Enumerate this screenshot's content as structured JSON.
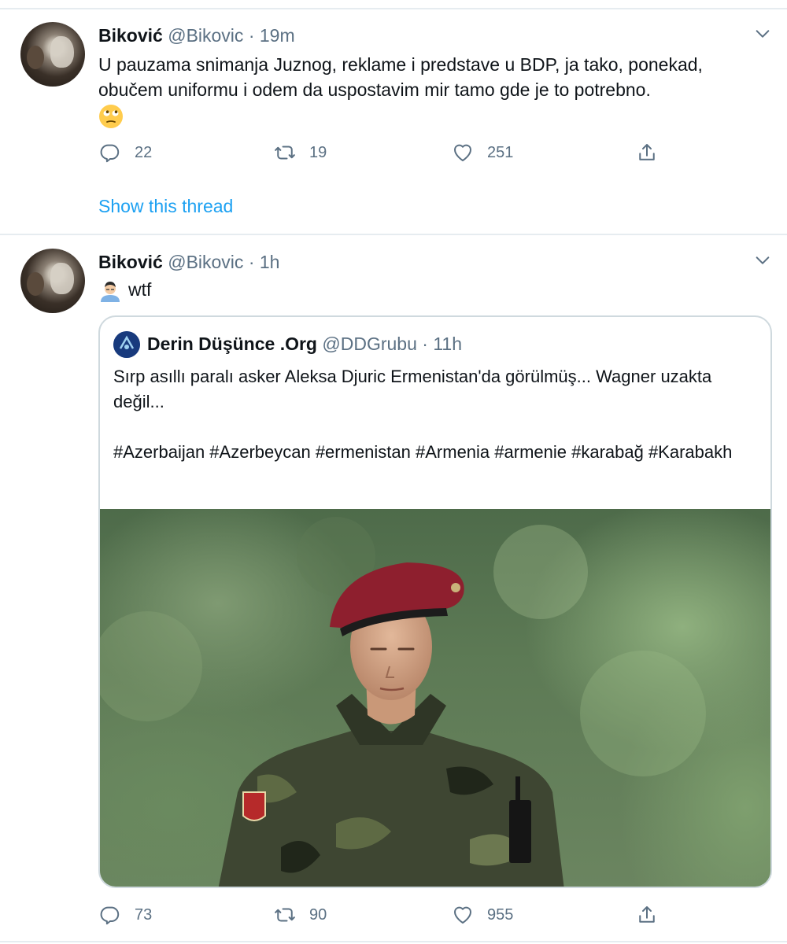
{
  "tweets": [
    {
      "name": "Biković",
      "handle": "@Bikovic",
      "time": "19m",
      "text": "U pauzama snimanja Juznog, reklame i predstave u BDP, ja tako, ponekad, obučem uniformu i odem da uspostavim mir tamo gde je to potrebno.",
      "emoji": "eye-roll-emoji",
      "replies": "22",
      "retweets": "19",
      "likes": "251",
      "show_thread": "Show this thread"
    },
    {
      "name": "Biković",
      "handle": "@Bikovic",
      "time": "1h",
      "text": "wtf",
      "emoji": "facepalm-emoji",
      "replies": "73",
      "retweets": "90",
      "likes": "955",
      "quote": {
        "name": "Derin Düşünce .Org",
        "handle": "@DDGrubu",
        "time": "11h",
        "line1": "Sırp asıllı paralı asker Aleksa Djuric Ermenistan'da görülmüş... Wagner uzakta değil...",
        "hashtags": "#Azerbaijan #Azerbeycan #ermenistan #Armenia #armenie #karabağ #Karabakh",
        "image": "soldier-in-red-beret-photo"
      }
    }
  ],
  "separator": "·",
  "icons": {
    "reply": "reply-icon",
    "retweet": "retweet-icon",
    "like": "heart-icon",
    "share": "share-icon",
    "more": "chevron-down-icon"
  },
  "colors": {
    "link": "#1da1f2",
    "secondary_text": "#5b7083",
    "border": "#cfd9de",
    "beret": "#8e1f2e"
  }
}
